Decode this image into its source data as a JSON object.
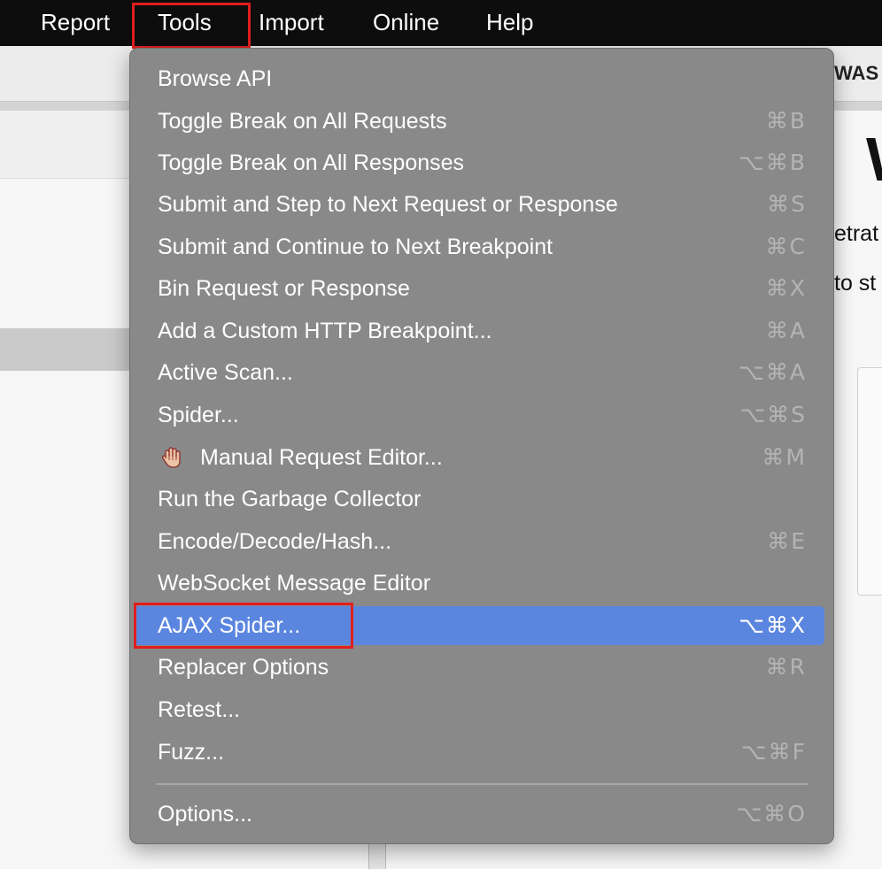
{
  "menubar": {
    "items": [
      "Report",
      "Tools",
      "Import",
      "Online",
      "Help"
    ]
  },
  "background": {
    "toolbar_text": "WAS",
    "heading_fragment": "W",
    "line1": "etrat",
    "line2": "to st"
  },
  "tools_menu": {
    "items": [
      {
        "label": "Browse API",
        "shortcut": ""
      },
      {
        "label": "Toggle Break on All Requests",
        "shortcut": "⌘B"
      },
      {
        "label": "Toggle Break on All Responses",
        "shortcut": "⌥⌘B"
      },
      {
        "label": "Submit and Step to Next Request or Response",
        "shortcut": "⌘S"
      },
      {
        "label": "Submit and Continue to Next Breakpoint",
        "shortcut": "⌘C"
      },
      {
        "label": "Bin Request or Response",
        "shortcut": "⌘X"
      },
      {
        "label": "Add a Custom HTTP Breakpoint...",
        "shortcut": "⌘A"
      },
      {
        "label": "Active Scan...",
        "shortcut": "⌥⌘A"
      },
      {
        "label": "Spider...",
        "shortcut": "⌥⌘S"
      },
      {
        "label": "Manual Request Editor...",
        "shortcut": "⌘M",
        "icon": "hand-icon"
      },
      {
        "label": "Run the Garbage Collector",
        "shortcut": ""
      },
      {
        "label": "Encode/Decode/Hash...",
        "shortcut": "⌘E"
      },
      {
        "label": "WebSocket Message Editor",
        "shortcut": ""
      },
      {
        "label": "AJAX Spider...",
        "shortcut": "⌥⌘X",
        "selected": true
      },
      {
        "label": "Replacer Options",
        "shortcut": "⌘R"
      },
      {
        "label": "Retest...",
        "shortcut": ""
      },
      {
        "label": "Fuzz...",
        "shortcut": "⌥⌘F"
      },
      {
        "label": "Options...",
        "shortcut": "⌥⌘O"
      }
    ]
  },
  "colors": {
    "menu_background": "#898989",
    "selection": "#5b86e0",
    "annotation_box": "#e01e1e",
    "menubar": "#0d0d0d"
  }
}
